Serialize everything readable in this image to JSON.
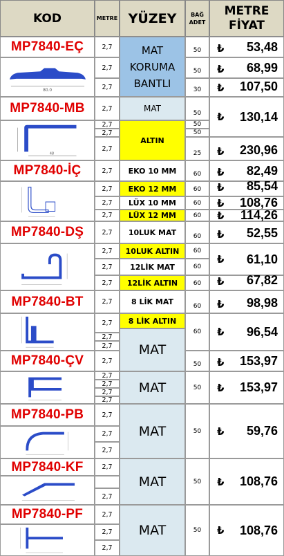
{
  "header": {
    "kod": "KOD",
    "metre": "METRE",
    "yuzey": "YÜZEY",
    "bag_adet_1": "BAĞ",
    "bag_adet_2": "ADET",
    "metre_fiyat_1": "METRE",
    "metre_fiyat_2": "FİYAT"
  },
  "currency": "₺",
  "metre_value": "2,7",
  "codes": [
    "MP7840-EÇ",
    "MP7840-MB",
    "MP7840-İÇ",
    "MP7840-DŞ",
    "MP7840-BT",
    "MP7840-ÇV",
    "MP7840-PB",
    "MP7840-KF",
    "MP7840-PF"
  ],
  "surfaces": {
    "ec": "MAT KORUMA BANTLI",
    "mb_mat": "MAT",
    "mb_altin": "ALTIN",
    "ic": [
      "EKO 10 MM",
      "EKO 12 MM",
      "LÜX 10 MM",
      "LÜX 12 MM"
    ],
    "ds": [
      "10LUK MAT",
      "10LUK ALTIN",
      "12LİK MAT",
      "12LİK ALTIN"
    ],
    "bt": [
      "8 LİK MAT",
      "8 LİK ALTIN"
    ],
    "mat": "MAT"
  },
  "adet": {
    "a50": "50",
    "a30": "30",
    "a25": "25",
    "a60": "60"
  },
  "prices": {
    "ec": [
      "53,48",
      "68,99",
      "107,50"
    ],
    "mb": [
      "130,14",
      "230,96"
    ],
    "ic": [
      "82,49",
      "85,54",
      "108,76",
      "114,26"
    ],
    "ds": [
      "52,55",
      "61,10",
      "67,82"
    ],
    "bt": [
      "98,98",
      "96,54"
    ],
    "cv": [
      "153,97",
      "153,97"
    ],
    "pb": "59,76",
    "kf": "108,76",
    "pf": "108,76"
  },
  "colors": {
    "code_red": "#e00000",
    "header_bg": "#ddd9c4",
    "blue": "#9cc3e6",
    "light": "#dbe9f0",
    "yellow": "#ffff00",
    "profile": "#2b4cc8"
  }
}
